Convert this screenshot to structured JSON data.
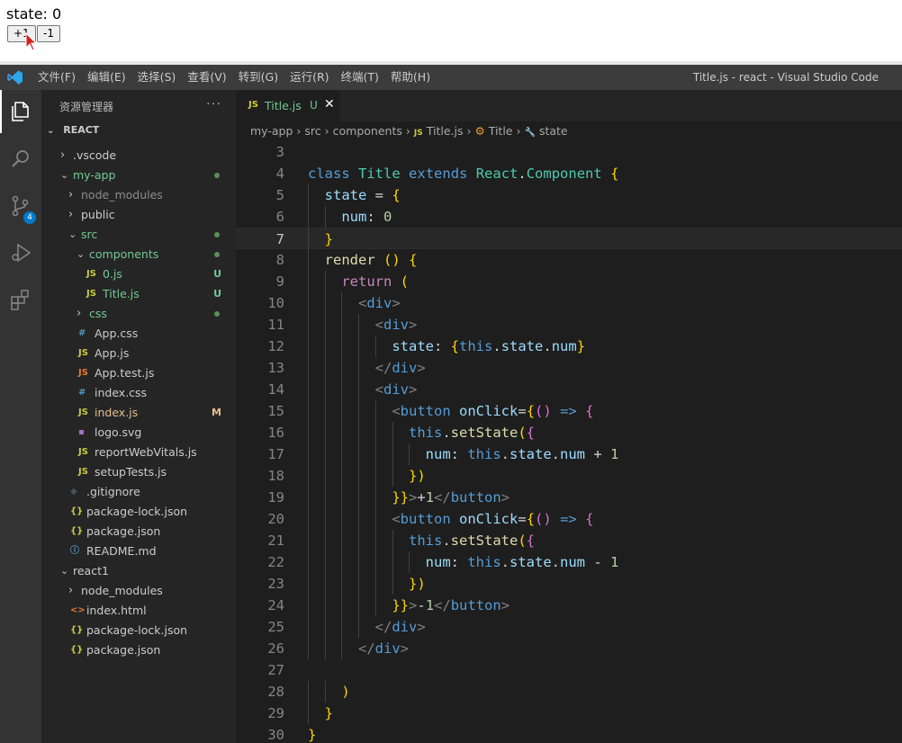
{
  "preview": {
    "state_label": "state: 0",
    "plus_label": "+1",
    "minus_label": "-1"
  },
  "titlebar": {
    "menu": [
      "文件(F)",
      "编辑(E)",
      "选择(S)",
      "查看(V)",
      "转到(G)",
      "运行(R)",
      "终端(T)",
      "帮助(H)"
    ],
    "window_title": "Title.js - react - Visual Studio Code"
  },
  "activitybar": {
    "icons": [
      "explorer-icon",
      "search-icon",
      "source-control-icon",
      "run-debug-icon",
      "extensions-icon"
    ],
    "source_control_badge": "4"
  },
  "sidebar": {
    "header": "资源管理器",
    "more": "···",
    "section": "REACT",
    "items": [
      {
        "label": ".vscode",
        "type": "folder",
        "state": "collapsed",
        "decoration": ""
      },
      {
        "label": "my-app",
        "type": "folder",
        "state": "expanded",
        "decoration": "dot",
        "color": "#73c991"
      },
      {
        "label": "node_modules",
        "type": "folder",
        "state": "collapsed",
        "decoration": "",
        "color": "#8c8c8c"
      },
      {
        "label": "public",
        "type": "folder",
        "state": "collapsed",
        "decoration": ""
      },
      {
        "label": "src",
        "type": "folder",
        "state": "expanded",
        "decoration": "dot",
        "color": "#73c991"
      },
      {
        "label": "components",
        "type": "folder",
        "state": "expanded",
        "decoration": "dot",
        "color": "#73c991"
      },
      {
        "label": "0.js",
        "type": "js",
        "decoration": "U",
        "color": "#73c991"
      },
      {
        "label": "Title.js",
        "type": "js",
        "decoration": "U",
        "color": "#73c991"
      },
      {
        "label": "css",
        "type": "folder",
        "state": "collapsed",
        "decoration": "dot",
        "color": "#73c991"
      },
      {
        "label": "App.css",
        "type": "css",
        "decoration": ""
      },
      {
        "label": "App.js",
        "type": "js",
        "decoration": ""
      },
      {
        "label": "App.test.js",
        "type": "test",
        "decoration": ""
      },
      {
        "label": "index.css",
        "type": "css",
        "decoration": ""
      },
      {
        "label": "index.js",
        "type": "js",
        "decoration": "M",
        "color": "#e2c08d"
      },
      {
        "label": "logo.svg",
        "type": "svg",
        "decoration": ""
      },
      {
        "label": "reportWebVitals.js",
        "type": "js",
        "decoration": ""
      },
      {
        "label": "setupTests.js",
        "type": "js",
        "decoration": ""
      },
      {
        "label": ".gitignore",
        "type": "git",
        "decoration": ""
      },
      {
        "label": "package-lock.json",
        "type": "json",
        "decoration": ""
      },
      {
        "label": "package.json",
        "type": "json",
        "decoration": ""
      },
      {
        "label": "README.md",
        "type": "info",
        "decoration": ""
      },
      {
        "label": "react1",
        "type": "folder",
        "state": "expanded",
        "decoration": ""
      },
      {
        "label": "node_modules",
        "type": "folder",
        "state": "collapsed",
        "decoration": ""
      },
      {
        "label": "index.html",
        "type": "html",
        "decoration": ""
      },
      {
        "label": "package-lock.json",
        "type": "json",
        "decoration": ""
      },
      {
        "label": "package.json",
        "type": "json",
        "decoration": ""
      }
    ]
  },
  "editor": {
    "tab": {
      "icon": "JS",
      "name": "Title.js",
      "status": "U"
    },
    "breadcrumb": [
      "my-app",
      "src",
      "components",
      "Title.js",
      "Title",
      "state"
    ],
    "current_line": 7,
    "lines": [
      {
        "n": "3",
        "code": ""
      },
      {
        "n": "4",
        "code": "class Title extends React.Component {"
      },
      {
        "n": "5",
        "code": "  state = {"
      },
      {
        "n": "6",
        "code": "    num: 0"
      },
      {
        "n": "7",
        "code": "  }"
      },
      {
        "n": "8",
        "code": "  render () {"
      },
      {
        "n": "9",
        "code": "    return ("
      },
      {
        "n": "10",
        "code": "      <div>"
      },
      {
        "n": "11",
        "code": "        <div>"
      },
      {
        "n": "12",
        "code": "          state: {this.state.num}"
      },
      {
        "n": "13",
        "code": "        </div>"
      },
      {
        "n": "14",
        "code": "        <div>"
      },
      {
        "n": "15",
        "code": "          <button onClick={() => {"
      },
      {
        "n": "16",
        "code": "            this.setState({"
      },
      {
        "n": "17",
        "code": "              num: this.state.num + 1"
      },
      {
        "n": "18",
        "code": "            })"
      },
      {
        "n": "19",
        "code": "          }}>+1</button>"
      },
      {
        "n": "20",
        "code": "          <button onClick={() => {"
      },
      {
        "n": "21",
        "code": "            this.setState({"
      },
      {
        "n": "22",
        "code": "              num: this.state.num - 1"
      },
      {
        "n": "23",
        "code": "            })"
      },
      {
        "n": "24",
        "code": "          }}>-1</button>"
      },
      {
        "n": "25",
        "code": "        </div>"
      },
      {
        "n": "26",
        "code": "      </div>"
      },
      {
        "n": "27",
        "code": ""
      },
      {
        "n": "28",
        "code": "    )"
      },
      {
        "n": "29",
        "code": "  }"
      },
      {
        "n": "30",
        "code": "}"
      }
    ]
  },
  "colors": {
    "accent": "#007acc",
    "untracked": "#73c991",
    "modified": "#e2c08d"
  }
}
